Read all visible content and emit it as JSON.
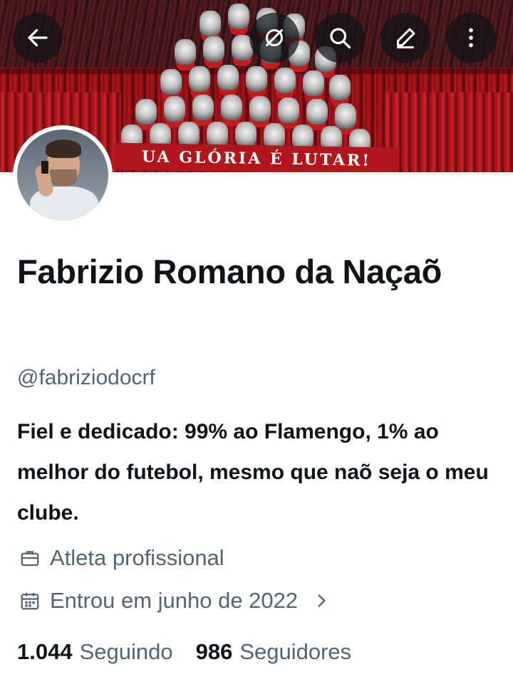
{
  "banner": {
    "tifo_text": "UA GLÓRIA É LUTAR!"
  },
  "top_bar": {
    "back_icon": "arrow-left-icon",
    "verify_icon": "link-off-icon",
    "search_icon": "search-icon",
    "edit_icon": "pencil-icon",
    "more_icon": "more-vertical-icon",
    "icon_color": "#ffffff",
    "button_bg": "rgba(15,20,25,0.72)"
  },
  "profile": {
    "display_name": "Fabrizio Romano da Naçaõ",
    "handle": "@fabriziodocrf",
    "bio": "Fiel e dedicado: 99% ao Flamengo, 1% ao melhor do futebol, mesmo que naõ seja o meu clube.",
    "profession": "Atleta profissional",
    "joined": "Entrou em junho de 2022",
    "following_count": "1.044",
    "following_label": "Seguindo",
    "followers_count": "986",
    "followers_label": "Seguidores"
  },
  "colors": {
    "text_primary": "#0f1419",
    "text_secondary": "#536471",
    "banner_red": "#b0161b"
  }
}
